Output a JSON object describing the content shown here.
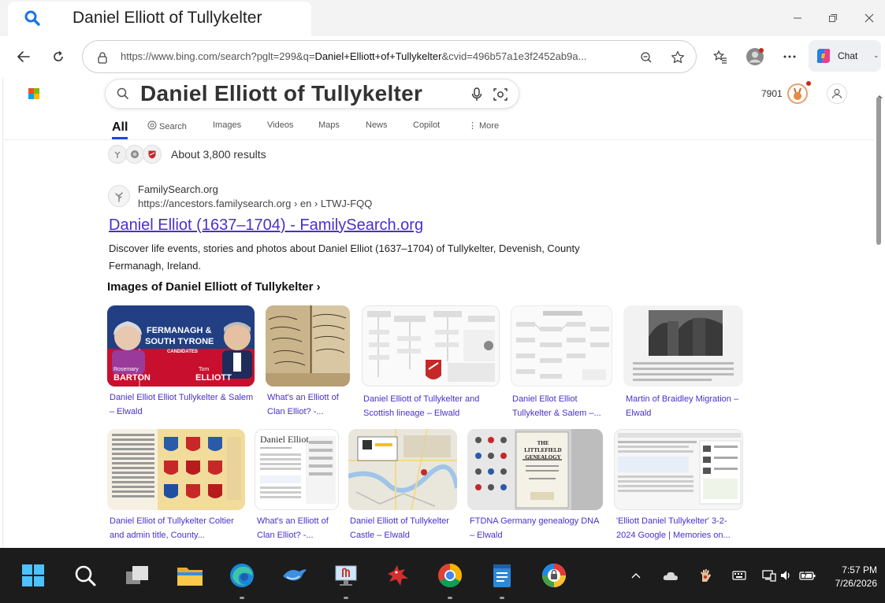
{
  "browser": {
    "tab_title": "Daniel Elliott of Tullykelter",
    "url_prefix": "https://www.bing.com/search?pglt=299&q=",
    "url_query": "Daniel+Elliott+of+Tullykelter",
    "url_suffix": "&cvid=496b57a1e3f2452ab9a...",
    "chat_label": "Chat"
  },
  "bing": {
    "search_query": "Daniel Elliott of Tullykelter",
    "rewards_points": "7901",
    "scopes": [
      {
        "label": "All"
      },
      {
        "label": "Search"
      },
      {
        "label": "Images"
      },
      {
        "label": "Videos"
      },
      {
        "label": "Maps"
      },
      {
        "label": "News"
      },
      {
        "label": "Copilot"
      },
      {
        "label": "More"
      }
    ],
    "results_count": "About 3,800 results"
  },
  "result": {
    "site_name": "FamilySearch.org",
    "site_url": "https://ancestors.familysearch.org › en › LTWJ-FQQ",
    "title": "Daniel Elliot (1637–1704) - FamilySearch.org",
    "snippet": "Discover life events, stories and photos about Daniel Elliot (1637–1704) of Tullykelter, Devenish, County Fermanagh, Ireland."
  },
  "images": {
    "heading": "Images of Daniel Elliott of Tullykelter ›",
    "thumb1_text": {
      "line1": "FERMANAGH &",
      "line2": "SOUTH TYRONE",
      "line3": "CANDIDATES",
      "left_first": "Rosemary",
      "left_last": "BARTON",
      "right_first": "Tom",
      "right_last": "ELLIOTT"
    },
    "thumb7_title": "Daniel Elliot",
    "thumb9_title": "THE LITTLEFIELD GENEALOGY",
    "row1": [
      {
        "caption": "Daniel Elliot Elliot Tullykelter & Salem – Elwald"
      },
      {
        "caption": "What's an Elliott of Clan Elliot? -..."
      },
      {
        "caption": "Daniel Elliott of Tullykelter and Scottish lineage – Elwald"
      },
      {
        "caption": "Daniel Ellot Elliot Tullykelter & Salem –..."
      },
      {
        "caption": "Martin of Braidley Migration – Elwald"
      }
    ],
    "row2": [
      {
        "caption": "Daniel Elliot of Tullykelter Coltier and admin title, County..."
      },
      {
        "caption": "What's an Elliott of Clan Elliot? -..."
      },
      {
        "caption": "Daniel Elliott of Tullykelter Castle – Elwald"
      },
      {
        "caption": "FTDNA Germany genealogy DNA – Elwald"
      },
      {
        "caption": "'Elliott Daniel Tullykelter' 3-2-2024 Google | Memories on..."
      }
    ]
  },
  "taskbar": {
    "time": "7:57 PM",
    "date": "7/26/2026"
  },
  "colors": {
    "link": "#4b2fc9",
    "accent_blue": "#174ae4",
    "taskbar": "#1c1c1c"
  }
}
